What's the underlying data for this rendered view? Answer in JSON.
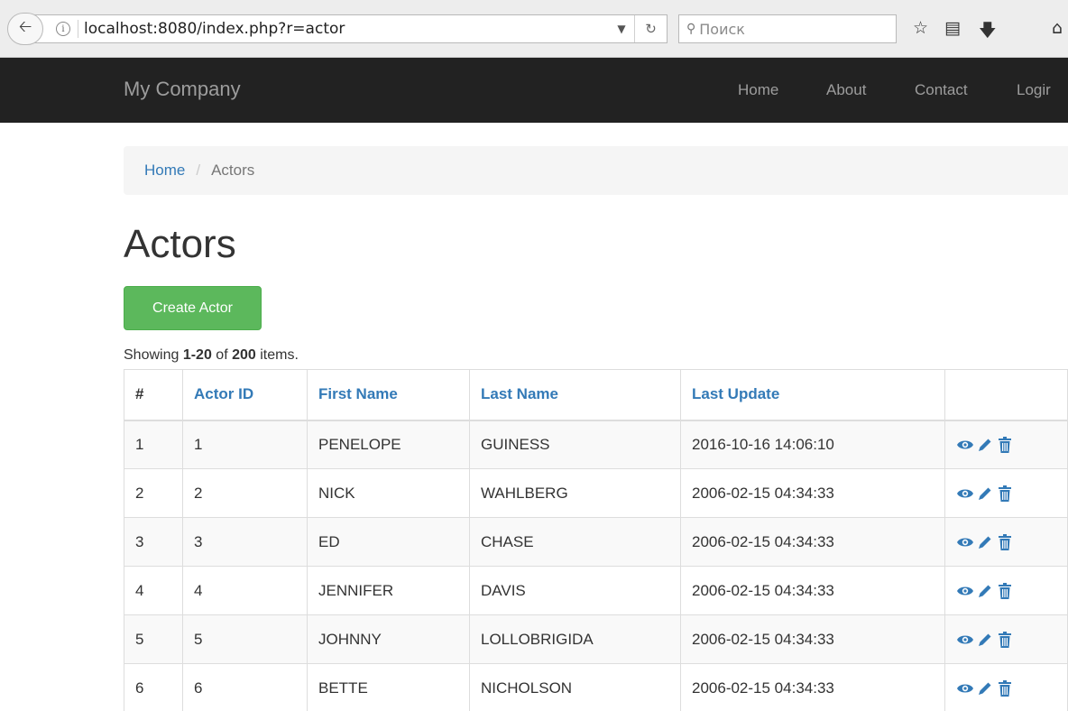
{
  "browser": {
    "url": "localhost:8080/index.php?r=actor",
    "search_placeholder": "Поиск"
  },
  "navbar": {
    "brand": "My Company",
    "links": [
      "Home",
      "About",
      "Contact",
      "Logir"
    ]
  },
  "breadcrumb": {
    "home": "Home",
    "separator": "/",
    "current": "Actors"
  },
  "page": {
    "title": "Actors",
    "create_button": "Create Actor"
  },
  "summary": {
    "prefix": "Showing ",
    "range": "1-20",
    "middle": " of ",
    "total": "200",
    "suffix": " items."
  },
  "table": {
    "headers": [
      "#",
      "Actor ID",
      "First Name",
      "Last Name",
      "Last Update"
    ],
    "rows": [
      [
        "1",
        "1",
        "PENELOPE",
        "GUINESS",
        "2016-10-16 14:06:10"
      ],
      [
        "2",
        "2",
        "NICK",
        "WAHLBERG",
        "2006-02-15 04:34:33"
      ],
      [
        "3",
        "3",
        "ED",
        "CHASE",
        "2006-02-15 04:34:33"
      ],
      [
        "4",
        "4",
        "JENNIFER",
        "DAVIS",
        "2006-02-15 04:34:33"
      ],
      [
        "5",
        "5",
        "JOHNNY",
        "LOLLOBRIGIDA",
        "2006-02-15 04:34:33"
      ],
      [
        "6",
        "6",
        "BETTE",
        "NICHOLSON",
        "2006-02-15 04:34:33"
      ]
    ],
    "row_actions": [
      "eye-icon",
      "pencil-icon",
      "trash-icon"
    ]
  },
  "colors": {
    "navbar_bg": "#222222",
    "link": "#337ab7",
    "success": "#5cb85c"
  }
}
